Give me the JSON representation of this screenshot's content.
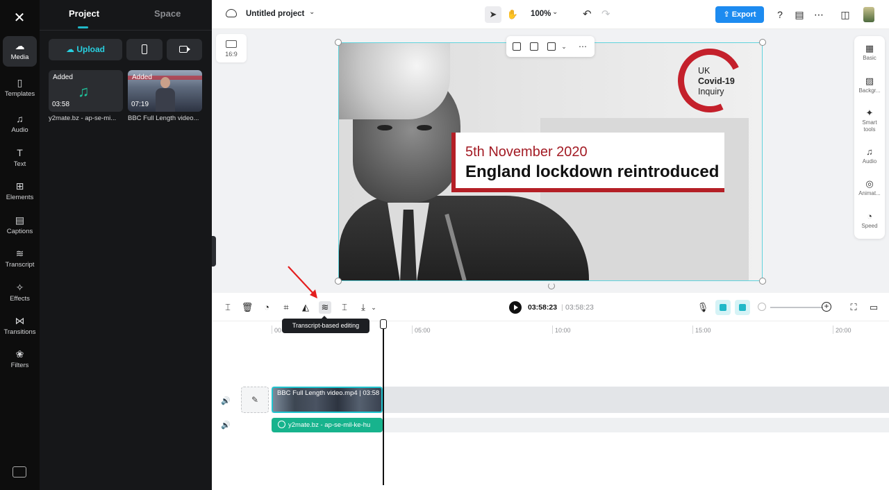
{
  "rail": {
    "items": [
      {
        "label": "Media",
        "icon": "cloud-upload-icon"
      },
      {
        "label": "Templates",
        "icon": "templates-icon"
      },
      {
        "label": "Audio",
        "icon": "music-icon"
      },
      {
        "label": "Text",
        "icon": "text-icon"
      },
      {
        "label": "Elements",
        "icon": "elements-icon"
      },
      {
        "label": "Captions",
        "icon": "captions-icon"
      },
      {
        "label": "Transcript",
        "icon": "transcript-icon"
      },
      {
        "label": "Effects",
        "icon": "effects-icon"
      },
      {
        "label": "Transitions",
        "icon": "transitions-icon"
      },
      {
        "label": "Filters",
        "icon": "filters-icon"
      }
    ]
  },
  "panel": {
    "tabs": [
      "Project",
      "Space"
    ],
    "upload_label": "Upload",
    "media": [
      {
        "badge": "Added",
        "duration": "03:58",
        "name": "y2mate.bz - ap-se-mi..."
      },
      {
        "badge": "Added",
        "duration": "07:19",
        "name": "BBC Full Length video..."
      }
    ]
  },
  "topbar": {
    "title": "Untitled project",
    "zoom": "100%",
    "export_label": "Export"
  },
  "canvas": {
    "ratio": "16:9",
    "lower_third_date": "5th November 2020",
    "lower_third_title": "England lockdown reintroduced",
    "logo": {
      "l1": "UK",
      "l2": "Covid-19",
      "l3": "Inquiry"
    }
  },
  "right_panel": {
    "items": [
      {
        "label": "Basic",
        "icon": "basic-icon"
      },
      {
        "label": "Backgr...",
        "icon": "background-icon"
      },
      {
        "label": "Smart tools",
        "icon": "magic-wand-icon"
      },
      {
        "label": "Audio",
        "icon": "music-icon"
      },
      {
        "label": "Animat...",
        "icon": "animation-icon"
      },
      {
        "label": "Speed",
        "icon": "speed-icon"
      }
    ]
  },
  "timeline": {
    "current_time": "03:58:23",
    "separator": "|",
    "total_time": "03:58:23",
    "tooltip": "Transcript-based editing",
    "ruler": [
      "00",
      "05:00",
      "10:00",
      "15:00",
      "20:00"
    ],
    "video_clip": "BBC Full Length video.mp4 | 03:58",
    "audio_clip": "y2mate.bz - ap-se-mil-ke-hu"
  }
}
